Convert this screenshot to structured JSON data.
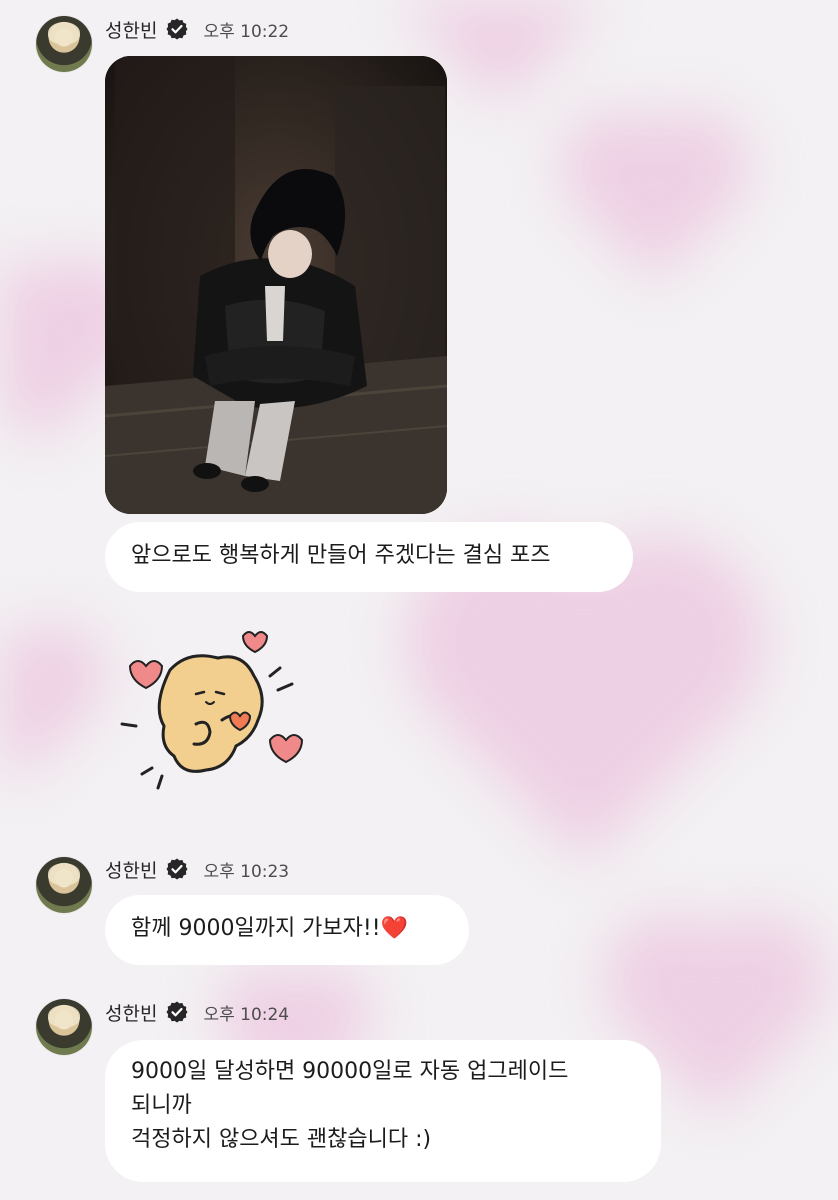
{
  "colors": {
    "bubble": "#ffffff",
    "heart_red": "#e23b3b",
    "wallpaper_pink": "#ecc4df"
  },
  "messages": [
    {
      "sender": "성한빈",
      "time": "오후 10:22",
      "verified": "verified-badge-icon",
      "photo": "photo-attachment",
      "text": "앞으로도 행복하게 만들어 주겠다는 결심 포즈",
      "sticker": "heart-character-sticker"
    },
    {
      "sender": "성한빈",
      "time": "오후 10:23",
      "verified": "verified-badge-icon",
      "text": "함께 9000일까지 가보자!!",
      "emoji": "❤️"
    },
    {
      "sender": "성한빈",
      "time": "오후 10:24",
      "verified": "verified-badge-icon",
      "lines": [
        "9000일 달성하면 90000일로 자동 업그레이드",
        "되니까",
        "걱정하지 않으셔도 괜찮습니다 :)"
      ]
    }
  ]
}
